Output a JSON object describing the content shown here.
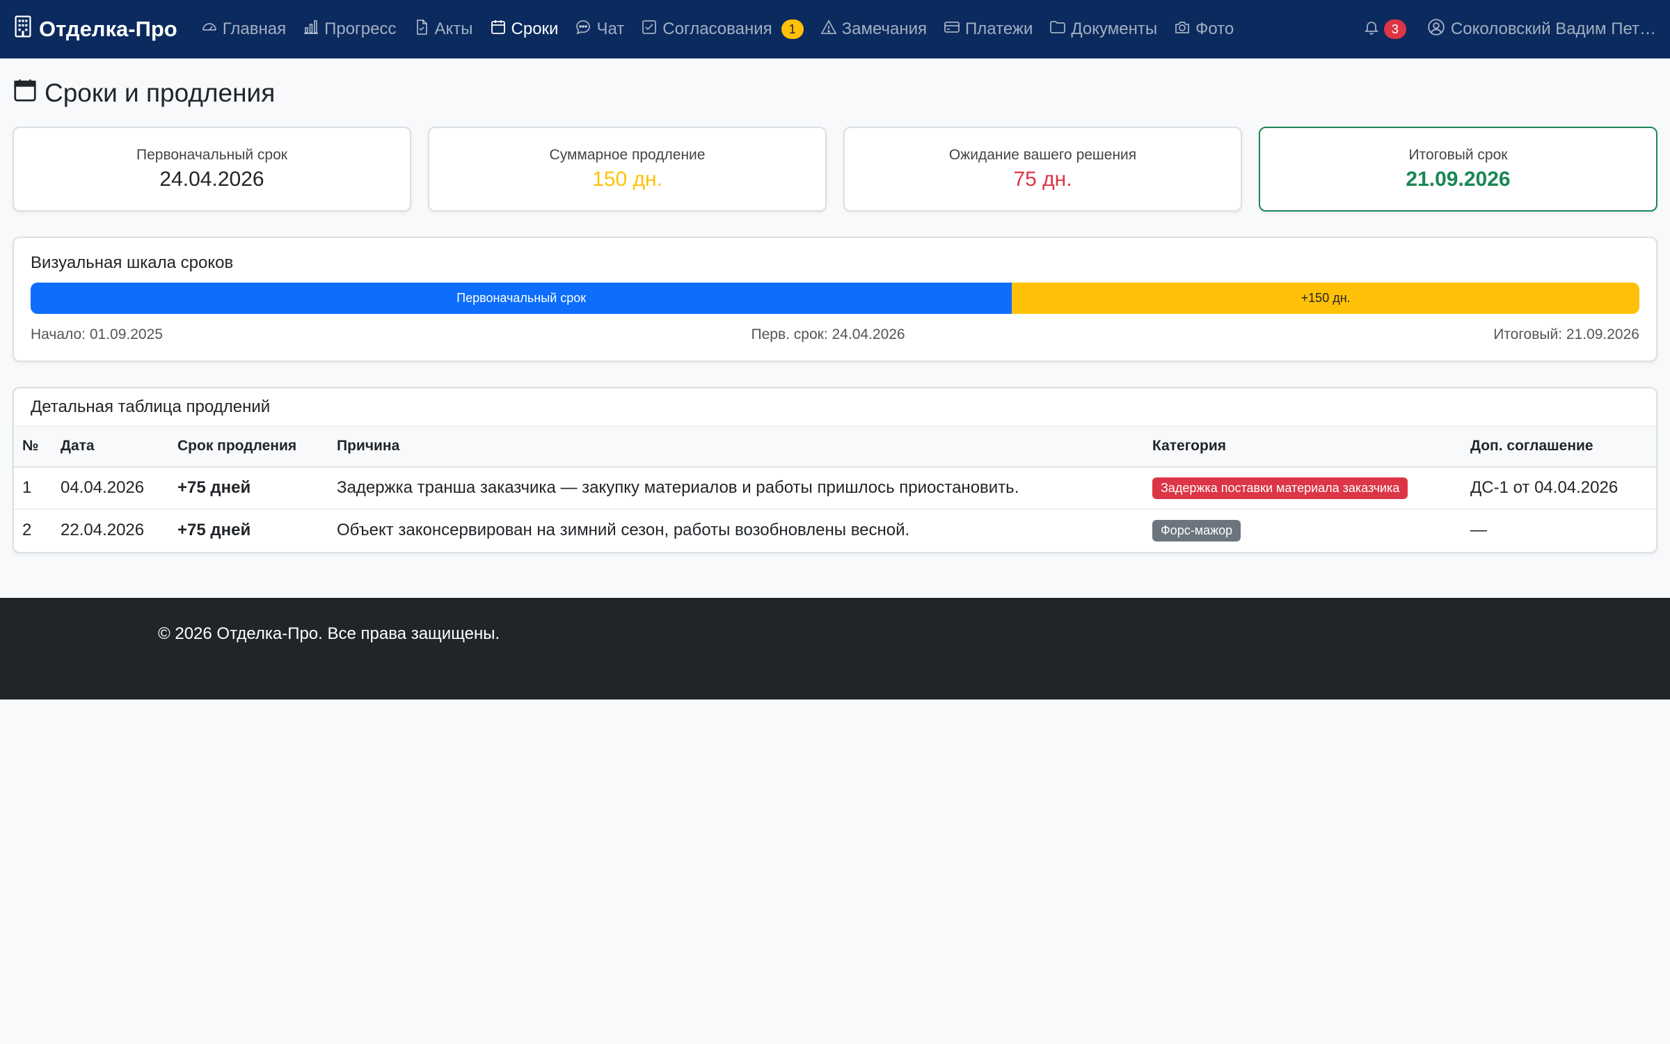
{
  "navbar": {
    "brand": "Отделка-Про",
    "links": [
      {
        "label": "Главная",
        "icon": "speedometer-icon"
      },
      {
        "label": "Прогресс",
        "icon": "bar-chart-icon"
      },
      {
        "label": "Акты",
        "icon": "file-check-icon"
      },
      {
        "label": "Сроки",
        "icon": "calendar-icon",
        "active": true
      },
      {
        "label": "Чат",
        "icon": "chat-dots-icon"
      },
      {
        "label": "Согласования",
        "icon": "check-square-icon",
        "badge": "1"
      },
      {
        "label": "Замечания",
        "icon": "warning-triangle-icon"
      },
      {
        "label": "Платежи",
        "icon": "credit-card-icon"
      },
      {
        "label": "Документы",
        "icon": "folder-icon"
      },
      {
        "label": "Фото",
        "icon": "camera-icon"
      }
    ],
    "notifications_count": "3",
    "user_name": "Соколовский Вадим Пет…"
  },
  "page": {
    "title": "Сроки и продления"
  },
  "stats": [
    {
      "label": "Первоначальный срок",
      "value": "24.04.2026"
    },
    {
      "label": "Суммарное продление",
      "value": "150 дн."
    },
    {
      "label": "Ожидание вашего решения",
      "value": "75 дн."
    },
    {
      "label": "Итоговый срок",
      "value": "21.09.2026"
    }
  ],
  "timeline": {
    "heading": "Визуальная шкала сроков",
    "segments": [
      {
        "label": "Первоначальный срок",
        "share": 0.61
      },
      {
        "label": "+150 дн.",
        "share": 0.39
      }
    ],
    "start_label": "Начало: 01.09.2025",
    "mid_label": "Перв. срок: 24.04.2026",
    "end_label": "Итоговый: 21.09.2026"
  },
  "extensions_table": {
    "heading": "Детальная таблица продлений",
    "columns": [
      "№",
      "Дата",
      "Срок продления",
      "Причина",
      "Категория",
      "Доп. соглашение"
    ],
    "rows": [
      {
        "num": "1",
        "date": "04.04.2026",
        "extension": "+75 дней",
        "reason": "Задержка транша заказчика — закупку материалов и работы пришлось приостановить.",
        "category": "Задержка поставки материала заказчика",
        "agreement": "ДС-1 от 04.04.2026"
      },
      {
        "num": "2",
        "date": "22.04.2026",
        "extension": "+75 дней",
        "reason": "Объект законсервирован на зимний сезон, работы возобновлены весной.",
        "category": "Форс-мажор",
        "agreement": "—"
      }
    ]
  },
  "footer": {
    "text": "© 2026 Отделка-Про. Все права защищены."
  },
  "colors": {
    "navbar": "#0b2a5e",
    "primary": "#0d6efd",
    "warning": "#ffc107",
    "danger": "#dc3545",
    "success": "#198754",
    "footer": "#212529"
  }
}
